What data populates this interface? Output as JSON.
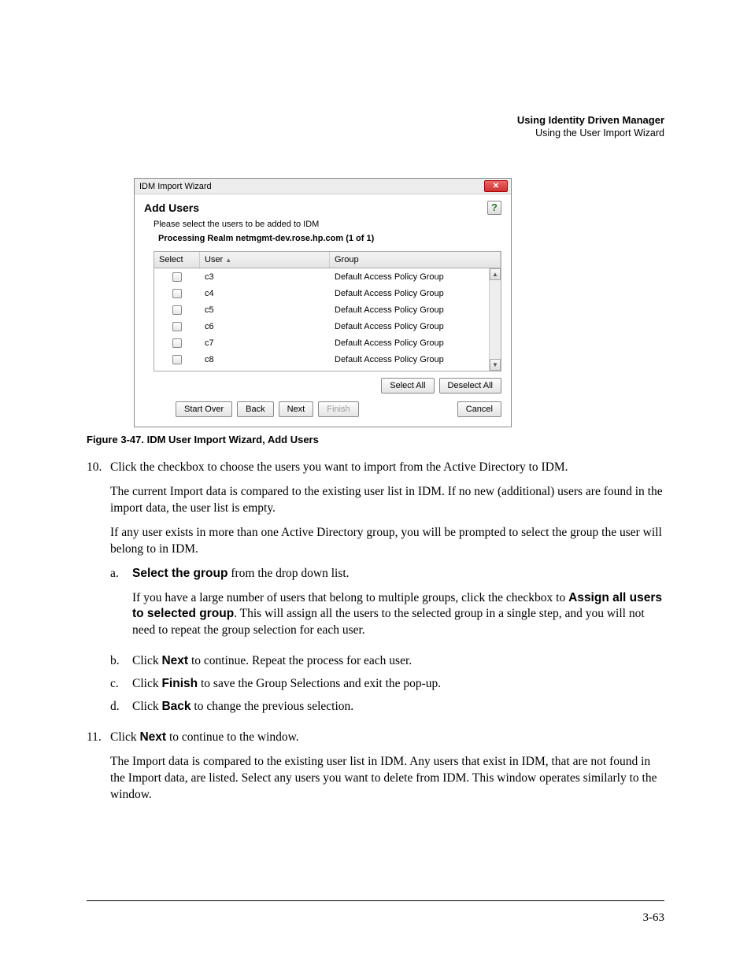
{
  "header": {
    "title": "Using Identity Driven Manager",
    "subtitle": "Using the User Import Wizard"
  },
  "dialog": {
    "window_title": "IDM Import Wizard",
    "heading": "Add Users",
    "instruction": "Please select the users to be added to IDM",
    "realm_line": "Processing Realm netmgmt-dev.rose.hp.com (1 of 1)",
    "columns": {
      "select": "Select",
      "user": "User",
      "group": "Group"
    },
    "rows": [
      {
        "user": "c3",
        "group": "Default Access Policy Group"
      },
      {
        "user": "c4",
        "group": "Default Access Policy Group"
      },
      {
        "user": "c5",
        "group": "Default Access Policy Group"
      },
      {
        "user": "c6",
        "group": "Default Access Policy Group"
      },
      {
        "user": "c7",
        "group": "Default Access Policy Group"
      },
      {
        "user": "c8",
        "group": "Default Access Policy Group"
      }
    ],
    "buttons": {
      "select_all": "Select All",
      "deselect_all": "Deselect All",
      "start_over": "Start Over",
      "back": "Back",
      "next": "Next",
      "finish": "Finish",
      "cancel": "Cancel"
    }
  },
  "figure_caption": "Figure 3-47. IDM User Import Wizard, Add Users",
  "steps": {
    "s10_num": "10.",
    "s10_a": "Click the ",
    "s10_b": " checkbox to choose the users you want to import from the Active Directory to IDM.",
    "s10_p1": "The current Import data is compared to the existing user list in IDM. If no new (additional) users are found in the import data, the user list is empty.",
    "s10_p2": "If any user exists in more than one Active Directory group, you will be prompted to select the group the user will belong to in IDM.",
    "a_letter": "a.",
    "a_bold": "Select the group",
    "a_rest": " from the drop down list.",
    "a_p_1": "If you have a large number of users that belong to multiple groups, click the checkbox to ",
    "a_p_bold": "Assign all users to selected group",
    "a_p_2": ". This will assign all the users to the selected group in a single step, and you will not need to repeat the group selection for each user.",
    "b_letter": "b.",
    "b_pre": "Click ",
    "b_bold": "Next",
    "b_post": " to continue. Repeat the process for each user.",
    "c_letter": "c.",
    "c_pre": "Click ",
    "c_bold": "Finish",
    "c_post": " to save the Group Selections and exit the pop-up.",
    "d_letter": "d.",
    "d_pre": "Click ",
    "d_bold": "Back",
    "d_post": " to change the previous selection.",
    "s11_num": "11.",
    "s11_pre": "Click ",
    "s11_bold": "Next",
    "s11_post": " to continue to the ",
    "s11_tail": " window.",
    "s11_p_1": "The Import data is compared to the existing user list in IDM. Any users that exist in IDM, that are not found in the Import data, are listed. Select any users you want to delete from IDM. This window operates similarly to the ",
    "s11_p_2": " window."
  },
  "page_number": "3-63"
}
